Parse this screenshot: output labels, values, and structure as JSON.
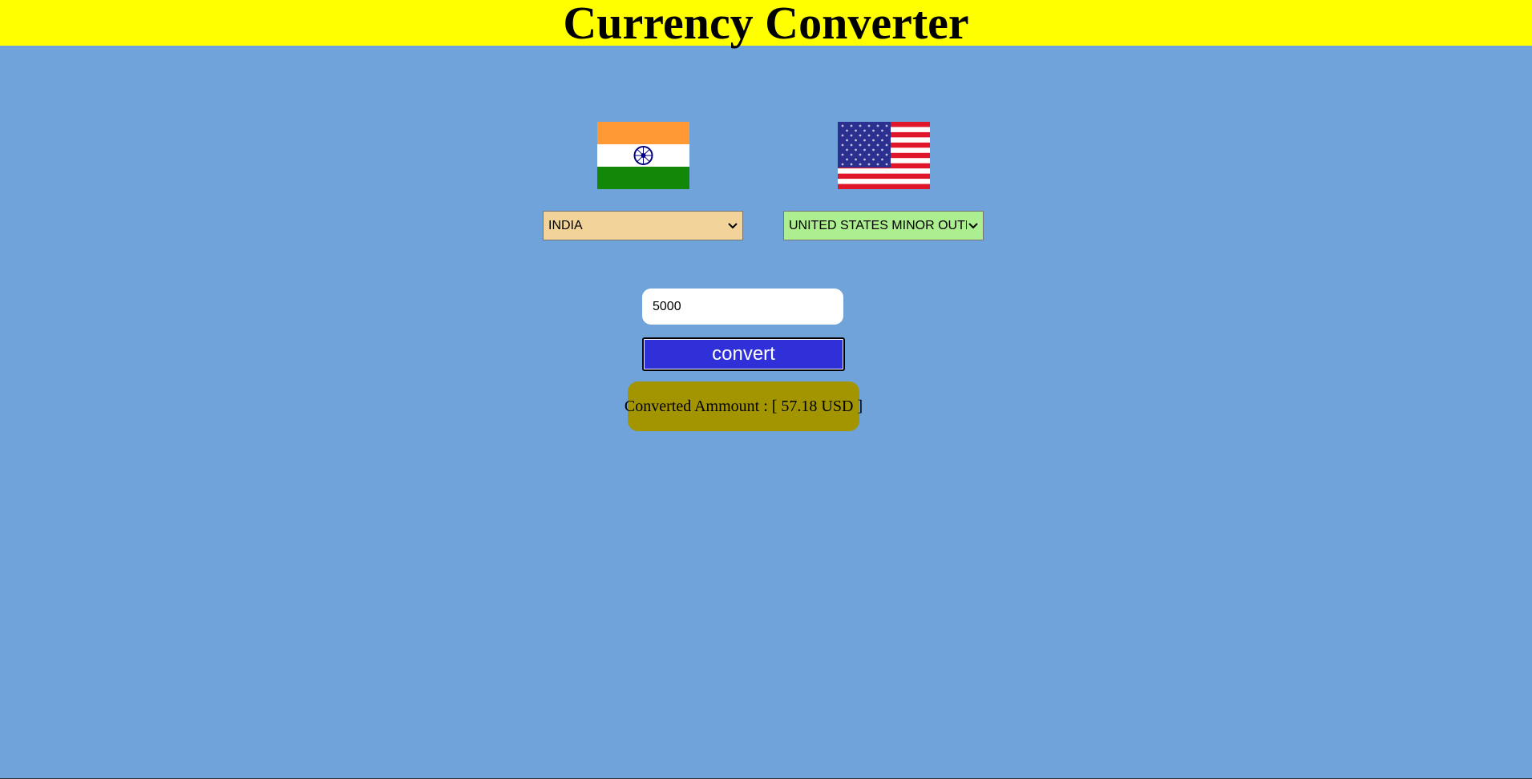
{
  "header": {
    "title": "Currency Converter"
  },
  "from": {
    "flag_icon": "india-flag-icon",
    "selected": "INDIA"
  },
  "to": {
    "flag_icon": "usa-flag-icon",
    "selected": "UNITED STATES MINOR OUTLYING ISLANDS"
  },
  "amount": {
    "value": "5000"
  },
  "convert_button": {
    "label": "convert"
  },
  "result": {
    "text": "Converted Ammount : [ 57.18 USD ]"
  },
  "colors": {
    "page_background": "#6fa3d9",
    "header_background": "#ffff00",
    "from_select_background": "#f2d49b",
    "to_select_background": "#adee91",
    "button_background": "#3030d9",
    "result_background": "#a39500"
  }
}
